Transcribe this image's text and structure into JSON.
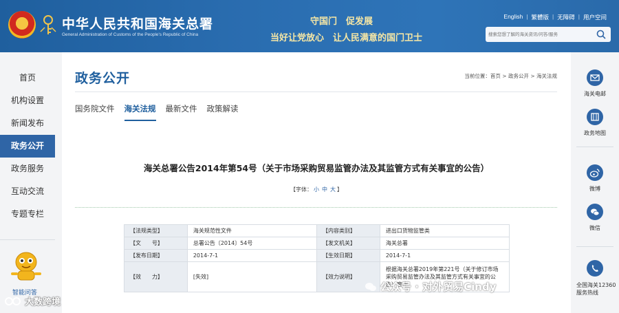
{
  "header": {
    "site_name": "中华人民共和国海关总署",
    "site_name_en": "General Administration of Customs of the People's Republic of China",
    "slogan_line1": "守国门　促发展",
    "slogan_line2": "当好让党放心　让人民满意的国门卫士",
    "top_links": [
      "English",
      "繁體版",
      "无障碍",
      "用户空间"
    ],
    "search_placeholder": "搜索您想了解的海关资讯/问答/服务"
  },
  "left_nav": {
    "items": [
      "首页",
      "机构设置",
      "新闻发布",
      "政务公开",
      "政务服务",
      "互动交流",
      "专题专栏"
    ],
    "active_index": 3,
    "assistant_label": "智能问答"
  },
  "main": {
    "page_title": "政务公开",
    "breadcrumb": "当前位置：首页 > 政务公开 > 海关法规",
    "tabs": [
      "国务院文件",
      "海关法规",
      "最新文件",
      "政策解读"
    ],
    "active_tab": 1,
    "doc_title": "海关总署公告2014年第54号（关于市场采购贸易监管办法及其监管方式有关事宜的公告）",
    "font_size": {
      "prefix": "【字体：",
      "small": "小",
      "medium": "中",
      "large": "大",
      "suffix": "】"
    },
    "info_table": [
      [
        "【法规类型】",
        "海关规范性文件",
        "【内容类别】",
        "进出口货物监管类"
      ],
      [
        "【文　　号】",
        "总署公告〔2014〕54号",
        "【发文机关】",
        "海关总署"
      ],
      [
        "【发布日期】",
        "2014-7-1",
        "【生效日期】",
        "2014-7-1"
      ],
      [
        "【效　　力】",
        "[失效]",
        "【效力说明】",
        "根据海关总署2019年第221号（关于修订市场采购贸易监管办法及其监管方式有关事宜的公告）废止"
      ]
    ]
  },
  "right_bar": {
    "items": [
      "海关电邮",
      "政务地图",
      "微博",
      "微信"
    ],
    "hotline": "全国海关12360服务热线"
  },
  "watermarks": {
    "left": "大数跨境",
    "right": "公众号 · 对外贸易Cindy"
  },
  "colors": {
    "header_blue": "#2a6db0",
    "nav_active": "#2f65a6",
    "slogan_gold": "#f6e7a5"
  }
}
